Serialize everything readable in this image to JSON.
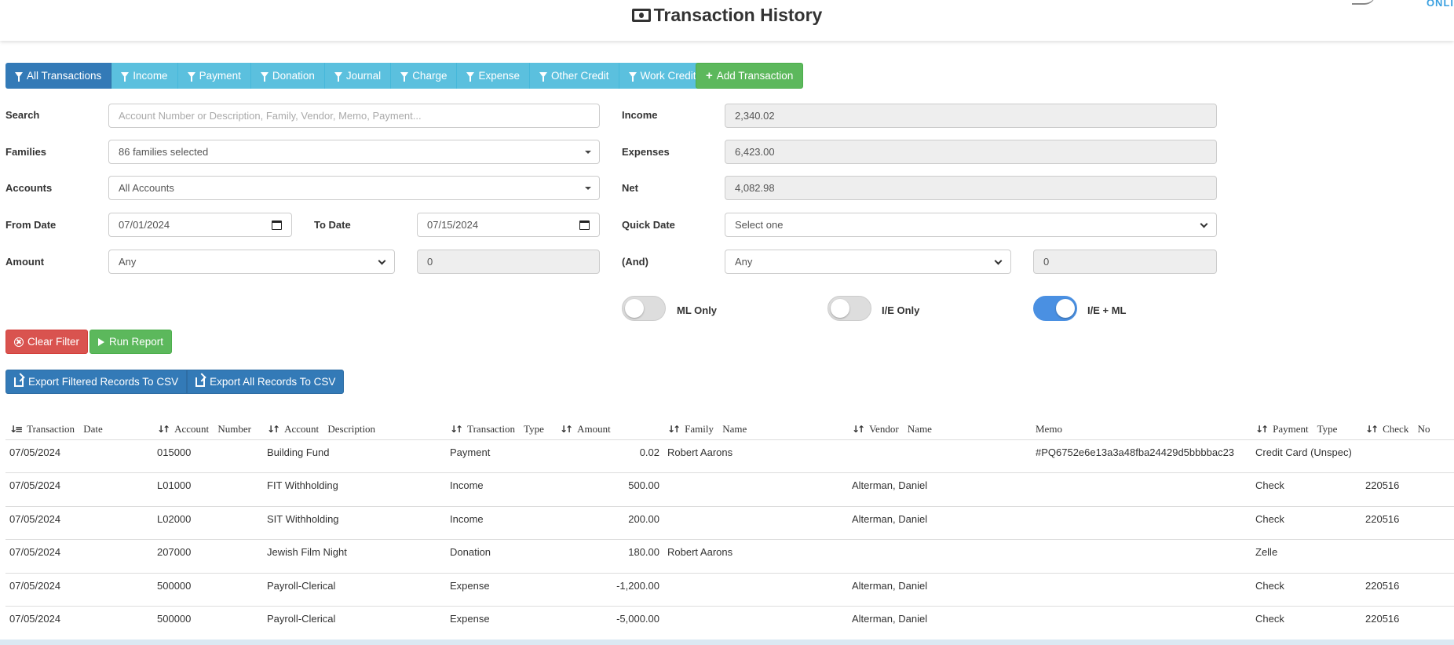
{
  "header": {
    "title": "Transaction History",
    "logo_text": "ONLI"
  },
  "filter_tabs": [
    {
      "label": "All Transactions",
      "active": true
    },
    {
      "label": "Income"
    },
    {
      "label": "Payment"
    },
    {
      "label": "Donation"
    },
    {
      "label": "Journal"
    },
    {
      "label": "Charge"
    },
    {
      "label": "Expense"
    },
    {
      "label": "Other Credit"
    },
    {
      "label": "Work Credit"
    }
  ],
  "add_button": "Add Transaction",
  "form": {
    "search_label": "Search",
    "search_placeholder": "Account Number or Description, Family, Vendor, Memo, Payment...",
    "families_label": "Families",
    "families_value": "86 families selected",
    "accounts_label": "Accounts",
    "accounts_value": "All Accounts",
    "from_date_label": "From Date",
    "from_date_value": "07/01/2024",
    "to_date_label": "To Date",
    "to_date_value": "07/15/2024",
    "amount_label": "Amount",
    "amount_op": "Any",
    "amount_value": "0",
    "income_label": "Income",
    "income_value": "2,340.02",
    "expenses_label": "Expenses",
    "expenses_value": "6,423.00",
    "net_label": "Net",
    "net_value": "4,082.98",
    "quick_date_label": "Quick Date",
    "quick_date_value": "Select one",
    "and_label": "(And)",
    "and_op": "Any",
    "and_value": "0"
  },
  "toggles": [
    {
      "label": "ML Only",
      "on": false
    },
    {
      "label": "I/E Only",
      "on": false
    },
    {
      "label": "I/E + ML",
      "on": true
    }
  ],
  "actions": {
    "clear": "Clear Filter",
    "run": "Run Report",
    "export_filtered": "Export Filtered Records To CSV",
    "export_all": "Export All Records To CSV"
  },
  "table": {
    "columns": [
      "Transaction Date",
      "Account Number",
      "Account Description",
      "Transaction Type",
      "Amount",
      "Family Name",
      "Vendor Name",
      "Memo",
      "Payment Type",
      "Check No"
    ],
    "rows": [
      [
        "07/05/2024",
        "015000",
        "Building Fund",
        "Payment",
        "0.02",
        "Robert Aarons",
        "",
        "#PQ6752e6e13a3a48fba24429d5bbbbac23",
        "Credit Card (Unspec)",
        ""
      ],
      [
        "07/05/2024",
        "L01000",
        "FIT Withholding",
        "Income",
        "500.00",
        "",
        "Alterman, Daniel",
        "",
        "Check",
        "220516"
      ],
      [
        "07/05/2024",
        "L02000",
        "SIT Withholding",
        "Income",
        "200.00",
        "",
        "Alterman, Daniel",
        "",
        "Check",
        "220516"
      ],
      [
        "07/05/2024",
        "207000",
        "Jewish Film Night",
        "Donation",
        "180.00",
        "Robert Aarons",
        "",
        "",
        "Zelle",
        ""
      ],
      [
        "07/05/2024",
        "500000",
        "Payroll-Clerical",
        "Expense",
        "-1,200.00",
        "",
        "Alterman, Daniel",
        "",
        "Check",
        "220516"
      ],
      [
        "07/05/2024",
        "500000",
        "Payroll-Clerical",
        "Expense",
        "-5,000.00",
        "",
        "Alterman, Daniel",
        "",
        "Check",
        "220516"
      ]
    ]
  }
}
